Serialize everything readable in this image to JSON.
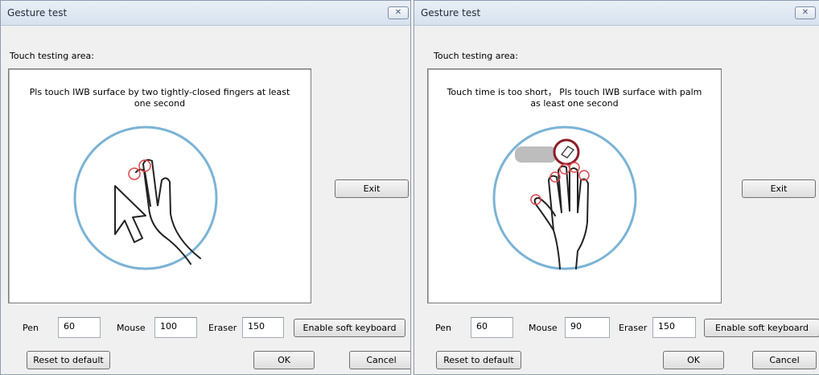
{
  "windows": [
    {
      "title": "Gesture test",
      "close_glyph": "✕",
      "touch_label": "Touch testing area:",
      "instruction": "Pls touch IWB surface by two tightly-closed fingers at least one second",
      "exit_label": "Exit",
      "pen_label": "Pen",
      "pen_value": "60",
      "mouse_label": "Mouse",
      "mouse_value": "100",
      "eraser_label": "Eraser",
      "eraser_value": "150",
      "keyboard_label": "Enable soft keyboard",
      "reset_label": "Reset to default",
      "ok_label": "OK",
      "cancel_label": "Cancel",
      "illustration": "two-finger-touch-icon"
    },
    {
      "title": "Gesture test",
      "close_glyph": "✕",
      "touch_label": "Touch testing area:",
      "instruction": "Touch time is too short， Pls touch IWB surface with palm as least one second",
      "exit_label": "Exit",
      "pen_label": "Pen",
      "pen_value": "60",
      "mouse_label": "Mouse",
      "mouse_value": "90",
      "eraser_label": "Eraser",
      "eraser_value": "150",
      "keyboard_label": "Enable soft keyboard",
      "reset_label": "Reset to default",
      "ok_label": "OK",
      "cancel_label": "Cancel",
      "illustration": "palm-eraser-touch-icon"
    }
  ],
  "colors": {
    "circle": "#7bb3d6",
    "touch_marker": "#e0474c",
    "eraser_ring": "#8b1e2b"
  }
}
